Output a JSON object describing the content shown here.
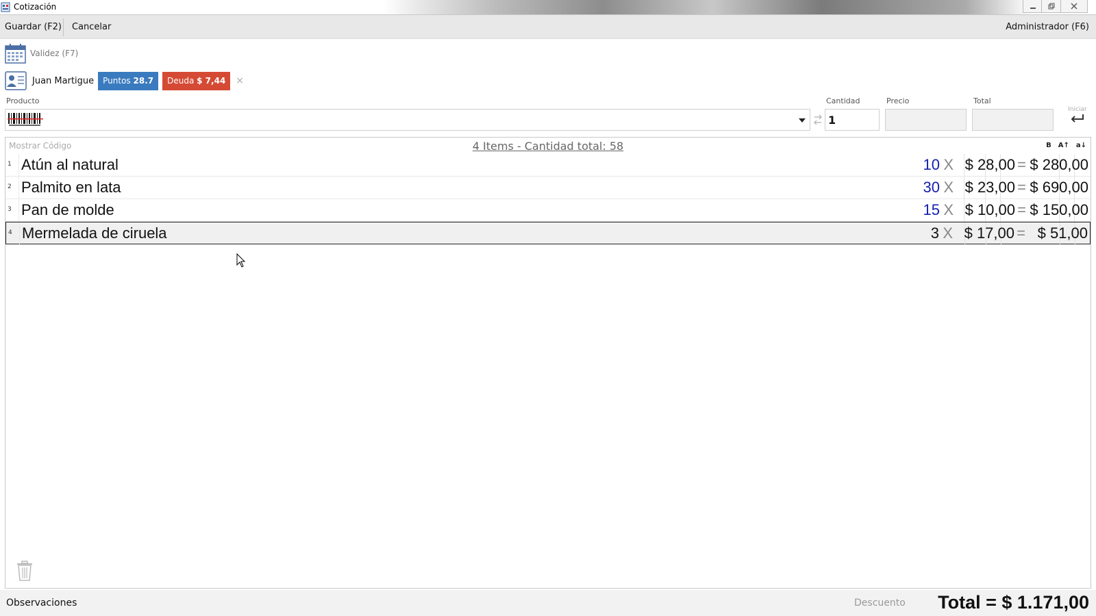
{
  "window": {
    "title": "Cotización",
    "icon": "app-icon"
  },
  "toolbar": {
    "save_label": "Guardar (F2)",
    "cancel_label": "Cancelar",
    "user_label": "Administrador (F6)"
  },
  "validity": {
    "label": "Validez (F7)",
    "icon": "calendar-icon"
  },
  "customer": {
    "name": "Juan Martigue",
    "points_label": "Puntos",
    "points_value": "28.7",
    "debt_label": "Deuda",
    "debt_value": "$ 7,44",
    "remove_label": "×",
    "colors": {
      "points": "#3a7bbf",
      "debt": "#d54a34"
    }
  },
  "entry": {
    "product_label": "Producto",
    "quantity_label": "Cantidad",
    "quantity_value": "1",
    "price_label": "Precio",
    "total_label": "Total",
    "start_label": "Iniciar",
    "barcode_icon": "barcode-icon"
  },
  "list": {
    "show_code_label": "Mostrar Código",
    "summary": "4 Items - Cantidad total: 58",
    "format_buttons": [
      "B",
      "A↑",
      "a↓"
    ],
    "items": [
      {
        "index": "1",
        "name": "Atún al natural",
        "qty": "10",
        "x": "X",
        "unit": "$ 28,00",
        "eq": "=",
        "subtotal": "$ 280,00"
      },
      {
        "index": "2",
        "name": "Palmito en lata",
        "qty": "30",
        "x": "X",
        "unit": "$ 23,00",
        "eq": "=",
        "subtotal": "$ 690,00"
      },
      {
        "index": "3",
        "name": "Pan de molde",
        "qty": "15",
        "x": "X",
        "unit": "$ 10,00",
        "eq": "=",
        "subtotal": "$ 150,00"
      },
      {
        "index": "4",
        "name": "Mermelada de ciruela",
        "qty": "3",
        "x": "X",
        "unit": "$ 17,00",
        "eq": "=",
        "subtotal": "$ 51,00"
      }
    ],
    "selected_index": 3
  },
  "footer": {
    "notes_label": "Observaciones",
    "discount_label": "Descuento",
    "total_label": "Total = $ 1.171,00"
  }
}
